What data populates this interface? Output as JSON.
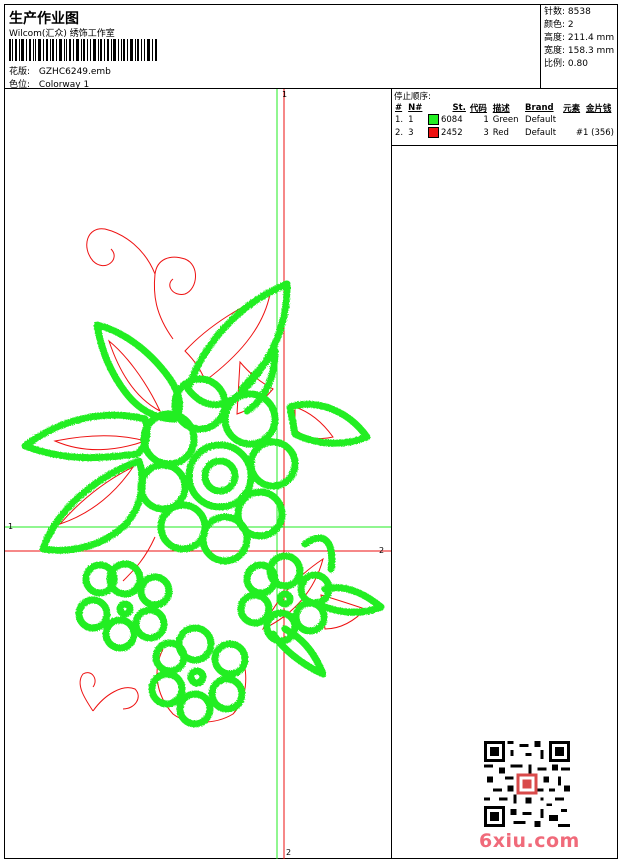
{
  "header": {
    "title": "生产作业图",
    "studio": "Wilcom(汇众) 绣饰工作室",
    "design_label": "花版:",
    "design_file": "GZHC6249.emb",
    "colorway_label": "色位:",
    "colorway": "Colorway 1"
  },
  "specs": [
    {
      "label": "针数:",
      "value": "8538"
    },
    {
      "label": "颜色:",
      "value": "2"
    },
    {
      "label": "高度:",
      "value": "211.4 mm"
    },
    {
      "label": "宽度:",
      "value": "158.3 mm"
    },
    {
      "label": "比例:",
      "value": "0.80"
    }
  ],
  "stop_sequence": {
    "title": "停止顺序:",
    "headers": [
      "#",
      "N#",
      "St.",
      "代码",
      "描述",
      "Brand",
      "元素",
      "金片钱"
    ],
    "rows": [
      {
        "idx": "1.",
        "n": "1",
        "color": "#22ee22",
        "code": "6084",
        "st": "1",
        "desc": "Green",
        "brand": "Default",
        "element": ""
      },
      {
        "idx": "2.",
        "n": "3",
        "color": "#ee1111",
        "code": "2452",
        "st": "3",
        "desc": "Red",
        "brand": "Default",
        "element": "#1 (356)"
      }
    ]
  },
  "axes": {
    "h1": "1",
    "h2": "2",
    "v1": "1",
    "v2": "2"
  },
  "watermark": "6xiu.com",
  "colors": {
    "green": "#22ee22",
    "red": "#ee1111"
  }
}
